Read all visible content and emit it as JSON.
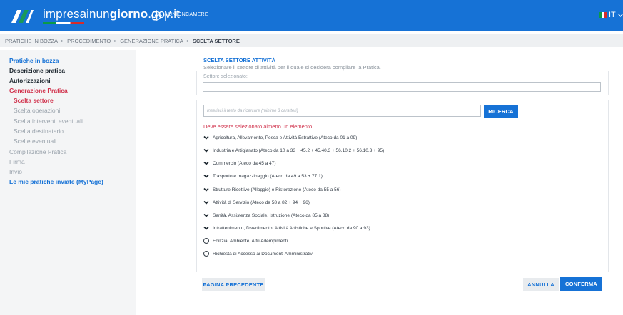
{
  "header": {
    "site_name_part1": "impresa",
    "site_name_part2": "inun",
    "site_name_part3": "giorno",
    "site_name_part4": ".gov.it",
    "partner": "UNIONCAMERE",
    "language": "IT",
    "brand_color": "#1672d6"
  },
  "breadcrumb": [
    "PRATICHE IN BOZZA",
    "PROCEDIMENTO",
    "GENERAZIONE PRATICA",
    "SCELTA SETTORE"
  ],
  "sidebar": {
    "items": [
      {
        "label": "Pratiche in bozza"
      },
      {
        "label": "Descrizione pratica"
      },
      {
        "label": "Autorizzazioni"
      },
      {
        "label": "Generazione Pratica"
      },
      {
        "label": "Scelta settore"
      },
      {
        "label": "Scelta operazioni"
      },
      {
        "label": "Scelta interventi eventuali"
      },
      {
        "label": "Scelta destinatario"
      },
      {
        "label": "Scelte eventuali"
      },
      {
        "label": "Compilazione Pratica"
      },
      {
        "label": "Firma"
      },
      {
        "label": "Invio"
      },
      {
        "label": "Le mie pratiche inviate (MyPage)"
      }
    ]
  },
  "main": {
    "title": "SCELTA SETTORE ATTIVITÀ",
    "description": "Selezionare il settore di attività per il quale si desidera compilare la Pratica.",
    "selected_label": "Settore selezionato:",
    "selected_value": "",
    "search_placeholder": "Inserisci il testo da ricercare (minimo 3 caratteri)",
    "search_button": "RICERCA",
    "error": "Deve essere selezionato almeno un elemento",
    "sectors": [
      {
        "label": "Agricoltura, Allevamento, Pesca e Attività Estrattive (Ateco da 01 a 09)",
        "icon": "chevron-down-icon"
      },
      {
        "label": "Industria e Artigianato (Ateco da 10 a 33 + 45.2 + 45.40.3 + 56.10.2 + 56.10.3 + 95)",
        "icon": "chevron-down-icon"
      },
      {
        "label": "Commercio (Ateco da 45 a 47)",
        "icon": "chevron-down-icon"
      },
      {
        "label": "Trasporto e magazzinaggio (Ateco da 49 a 53 + 77.1)",
        "icon": "chevron-down-icon"
      },
      {
        "label": "Strutture Ricettive (Alloggio) e Ristorazione (Ateco da 55 a 56)",
        "icon": "chevron-down-icon"
      },
      {
        "label": "Attività di Servizio (Ateco da 58 a 82 + 94 + 96)",
        "icon": "chevron-down-icon"
      },
      {
        "label": "Sanità, Assistenza Sociale, Istruzione (Ateco da 85 a 88)",
        "icon": "chevron-down-icon"
      },
      {
        "label": "Intrattenimento, Divertimento, Attività Artistiche e Sportive (Ateco da 90 a 93)",
        "icon": "chevron-down-icon"
      },
      {
        "label": "Edilizia, Ambiente, Altri Adempimenti",
        "icon": "radio-icon"
      },
      {
        "label": "Richiesta di Accesso ai Documenti Amministrativi",
        "icon": "radio-icon"
      }
    ]
  },
  "footer": {
    "prev_button": "PAGINA PRECEDENTE",
    "cancel_button": "ANNULLA",
    "confirm_button": "CONFERMA"
  }
}
